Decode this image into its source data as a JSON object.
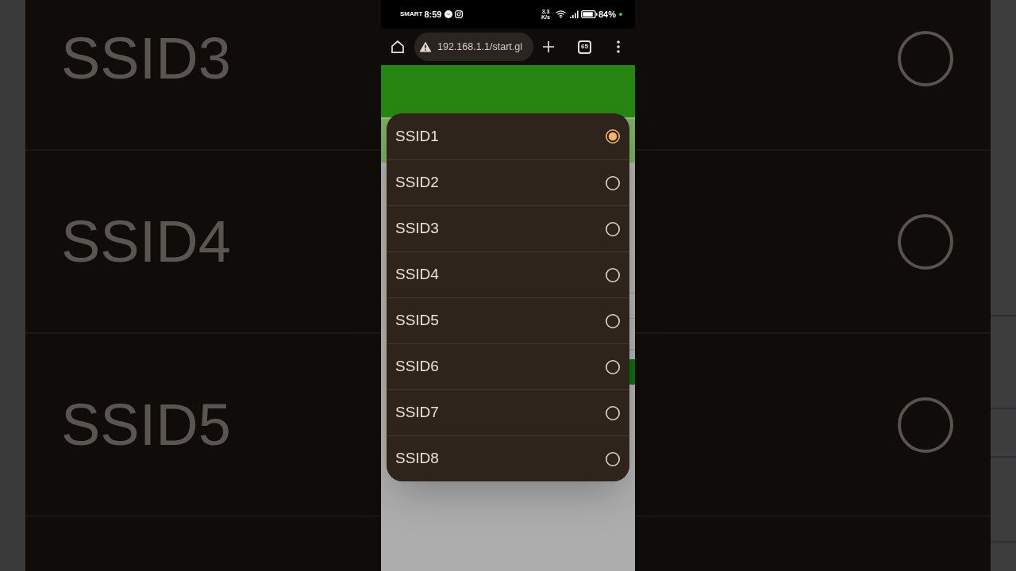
{
  "backdrop": {
    "rows": [
      {
        "label": "SSID3",
        "selected": false
      },
      {
        "label": "SSID4",
        "selected": false
      },
      {
        "label": "SSID5",
        "selected": false
      }
    ]
  },
  "status_bar": {
    "carrier": "SMART",
    "time": "8:59",
    "speed": "3.3",
    "speed_unit": "K/s",
    "battery": "84%"
  },
  "browser": {
    "url": "192.168.1.1/start.gl",
    "tab_count": "65"
  },
  "dialog": {
    "options": [
      {
        "label": "SSID1",
        "selected": true
      },
      {
        "label": "SSID2",
        "selected": false
      },
      {
        "label": "SSID3",
        "selected": false
      },
      {
        "label": "SSID4",
        "selected": false
      },
      {
        "label": "SSID5",
        "selected": false
      },
      {
        "label": "SSID6",
        "selected": false
      },
      {
        "label": "SSID7",
        "selected": false
      },
      {
        "label": "SSID8",
        "selected": false
      }
    ]
  }
}
